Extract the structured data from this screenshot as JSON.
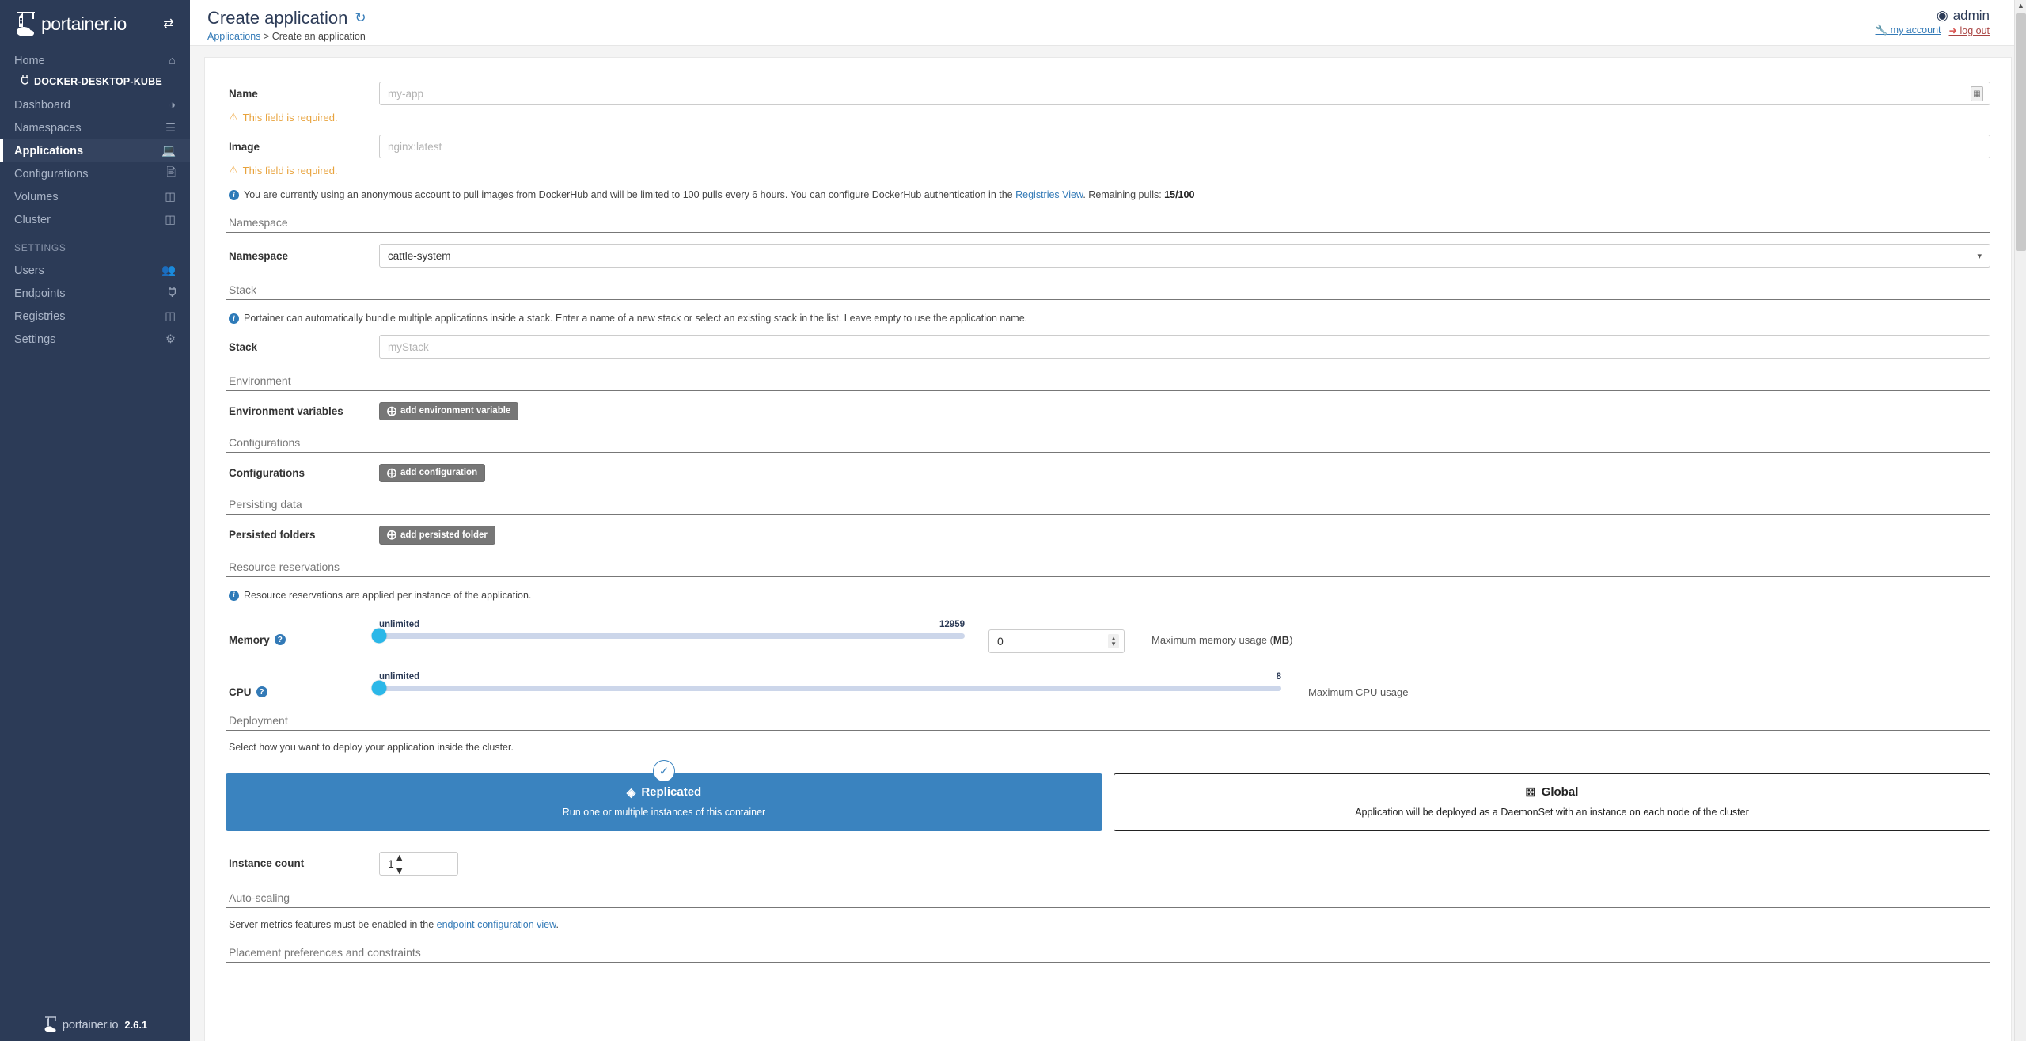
{
  "brand": {
    "name": "portainer.io",
    "version": "2.6.1",
    "accent": "#2c3b57",
    "link_color": "#337ab7",
    "warning_color": "#e8a33d",
    "selected_card_color": "#3a83bf",
    "slider_knob_color": "#2bb7e8"
  },
  "sidebar": {
    "collapse_icon": "⇄",
    "endpoint": {
      "label": "DOCKER-DESKTOP-KUBE",
      "icon": "plug-icon"
    },
    "items": [
      {
        "label": "Home",
        "icon": "home-icon",
        "active": false
      },
      {
        "label": "Dashboard",
        "icon": "dashboard-icon",
        "active": false
      },
      {
        "label": "Namespaces",
        "icon": "layers-icon",
        "active": false
      },
      {
        "label": "Applications",
        "icon": "laptop-code-icon",
        "active": true
      },
      {
        "label": "Configurations",
        "icon": "file-code-icon",
        "active": false
      },
      {
        "label": "Volumes",
        "icon": "database-icon",
        "active": false
      },
      {
        "label": "Cluster",
        "icon": "server-icon",
        "active": false
      }
    ],
    "settings_header": "SETTINGS",
    "settings_items": [
      {
        "label": "Users",
        "icon": "users-icon"
      },
      {
        "label": "Endpoints",
        "icon": "plug-icon"
      },
      {
        "label": "Registries",
        "icon": "database-icon"
      },
      {
        "label": "Settings",
        "icon": "cogs-icon"
      }
    ]
  },
  "header": {
    "title": "Create application",
    "refresh_icon": "sync-icon",
    "breadcrumb_root": "Applications",
    "breadcrumb_sep": ">",
    "breadcrumb_current": "Create an application",
    "user": "admin",
    "user_icon": "user-circle-icon",
    "my_account_label": "my account",
    "my_account_icon": "wrench-icon",
    "logout_label": "log out",
    "logout_icon": "sign-out-icon"
  },
  "form": {
    "name": {
      "label": "Name",
      "placeholder": "my-app",
      "value": "",
      "error": "This field is required.",
      "contact_icon": "contact-card-icon"
    },
    "image": {
      "label": "Image",
      "placeholder": "nginx:latest",
      "value": "",
      "error": "This field is required."
    },
    "dockerhub_notice": {
      "text_before": "You are currently using an anonymous account to pull images from DockerHub and will be limited to 100 pulls every 6 hours. You can configure DockerHub authentication in the ",
      "link": "Registries View",
      "text_after": ". Remaining pulls: ",
      "remaining": "15/100"
    },
    "namespace_section": "Namespace",
    "namespace": {
      "label": "Namespace",
      "value": "cattle-system",
      "chevron": "chevron-down-icon"
    },
    "stack_section": "Stack",
    "stack_notice": "Portainer can automatically bundle multiple applications inside a stack. Enter a name of a new stack or select an existing stack in the list. Leave empty to use the application name.",
    "stack": {
      "label": "Stack",
      "placeholder": "myStack",
      "value": ""
    },
    "environment_section": "Environment",
    "env_vars": {
      "label": "Environment variables",
      "button": "add environment variable"
    },
    "configurations_section": "Configurations",
    "configurations": {
      "label": "Configurations",
      "button": "add configuration"
    },
    "persisting_section": "Persisting data",
    "persisted_folders": {
      "label": "Persisted folders",
      "button": "add persisted folder"
    },
    "resource_section": "Resource reservations",
    "resource_notice": "Resource reservations are applied per instance of the application.",
    "memory": {
      "label": "Memory",
      "min_label": "unlimited",
      "max_label": "12959",
      "slider_value": 0,
      "input_value": "0",
      "note_text": "Maximum memory usage (",
      "note_unit": "MB",
      "note_suffix": ")"
    },
    "cpu": {
      "label": "CPU",
      "min_label": "unlimited",
      "max_label": "8",
      "slider_value": 0,
      "note": "Maximum CPU usage"
    },
    "deployment_section": "Deployment",
    "deployment_notice": "Select how you want to deploy your application inside the cluster.",
    "deployment_options": [
      {
        "title": "Replicated",
        "icon": "cubes-icon",
        "subtitle": "Run one or multiple instances of this container",
        "selected": true,
        "check_icon": "check-icon"
      },
      {
        "title": "Global",
        "icon": "sitemap-icon",
        "subtitle": "Application will be deployed as a DaemonSet with an instance on each node of the cluster",
        "selected": false
      }
    ],
    "instance_count": {
      "label": "Instance count",
      "value": "1"
    },
    "autoscaling_section": "Auto-scaling",
    "autoscaling_text_before": "Server metrics features must be enabled in the ",
    "autoscaling_link": "endpoint configuration view",
    "autoscaling_text_after": ".",
    "placement_section": "Placement preferences and constraints"
  }
}
